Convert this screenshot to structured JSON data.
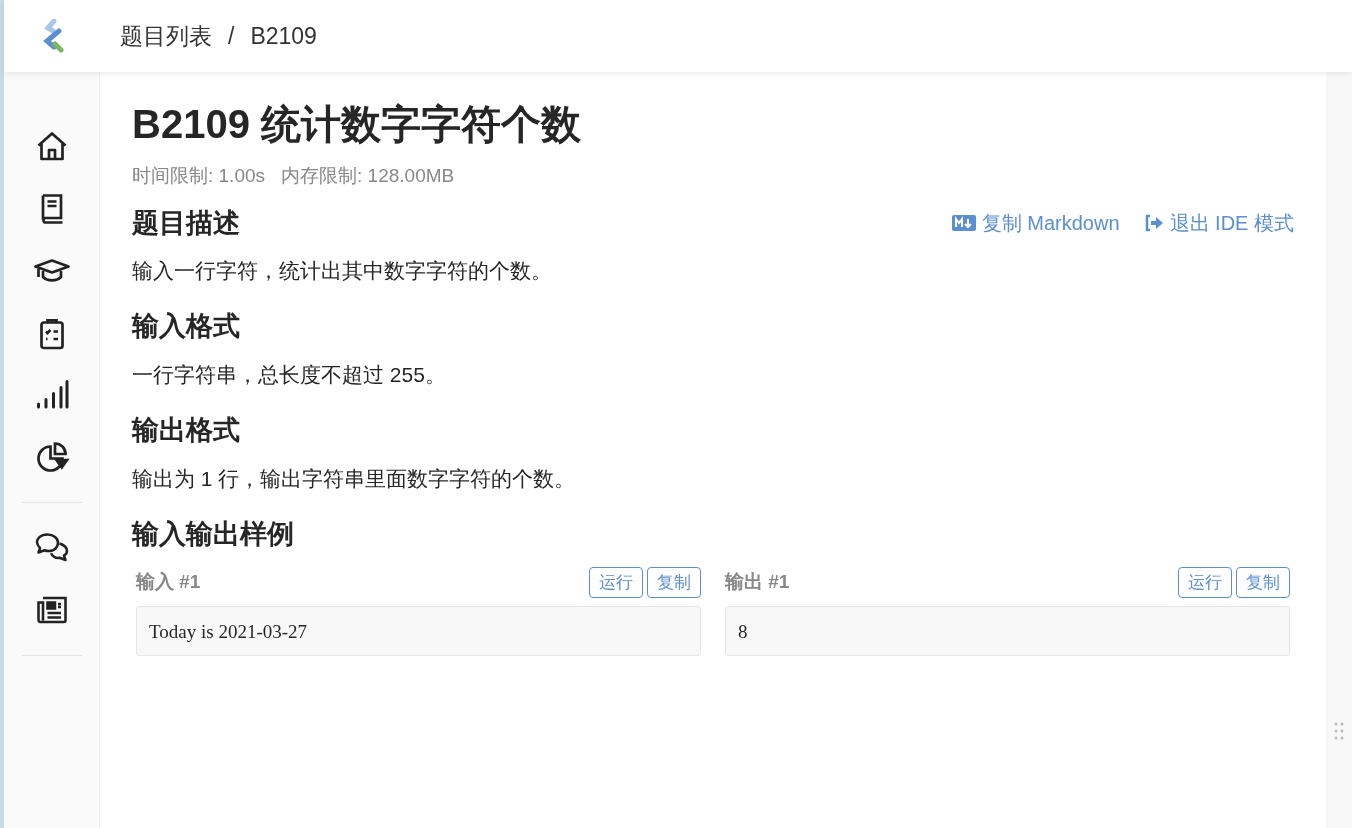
{
  "breadcrumb": [
    {
      "label": "题目列表"
    },
    {
      "label": "B2109"
    }
  ],
  "breadcrumb_separator": "/",
  "problem": {
    "title": "B2109 统计数字字符个数",
    "limits": [
      {
        "text": "时间限制: 1.00s"
      },
      {
        "text": "内存限制: 128.00MB"
      }
    ],
    "actions": [
      {
        "kind": "markdown",
        "label": "复制 Markdown"
      },
      {
        "kind": "exit",
        "label": "退出 IDE 模式"
      }
    ],
    "sections": [
      {
        "heading": "题目描述",
        "text": "输入一行字符，统计出其中数字字符的个数。"
      },
      {
        "heading": "输入格式",
        "text": "一行字符串，总长度不超过 255。"
      },
      {
        "heading": "输出格式",
        "text": "输出为 1 行，输出字符串里面数字字符的个数。"
      }
    ],
    "samples_heading": "输入输出样例",
    "samples": [
      {
        "label": "输入 #1",
        "buttons": [
          "运行",
          "复制"
        ],
        "content": "Today is 2021-03-27"
      },
      {
        "label": "输出 #1",
        "buttons": [
          "运行",
          "复制"
        ],
        "content": "8"
      }
    ]
  }
}
